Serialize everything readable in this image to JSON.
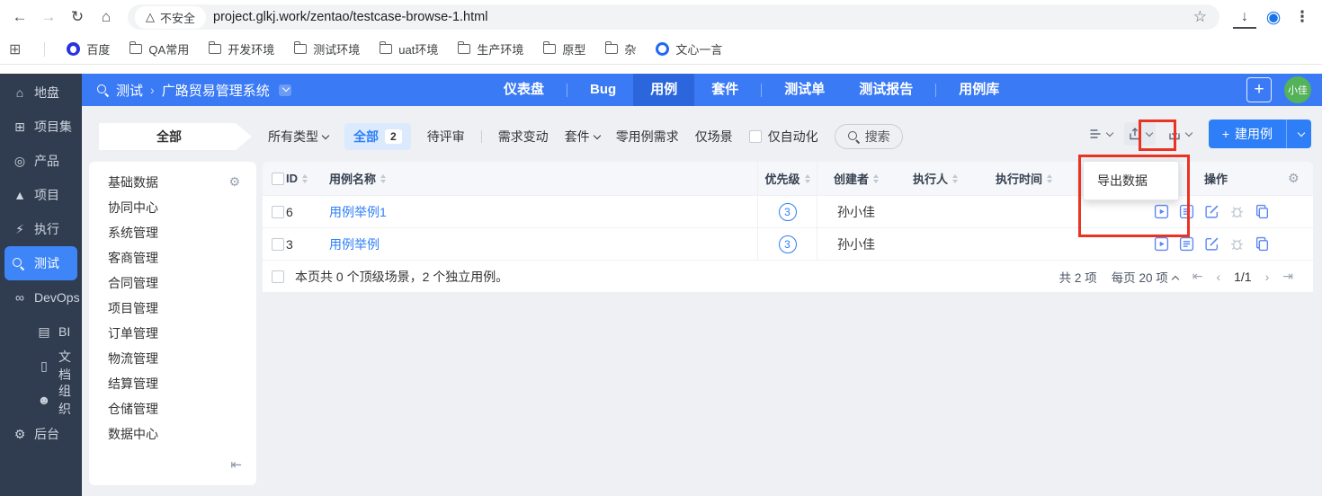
{
  "colors": {
    "primary_blue": "#3a7af5",
    "active_tab_blue": "#2b66dd",
    "sidebar_bg": "#303c4f",
    "sidebar_active_blue": "#3e86f7",
    "link_blue": "#2e7ff7",
    "annotation_red": "#ea3323",
    "avatar_green": "#53b25a"
  },
  "icons": {
    "home": "⌂",
    "grid": "⊞",
    "bulb": "◎",
    "rocket": "▲",
    "run": "⚡",
    "search": "",
    "infinity": "∞",
    "chart": "▤",
    "doc": "▯",
    "people": "☻",
    "gear": "⚙",
    "back": "←",
    "forward": "→",
    "reload": "↻",
    "star": "☆",
    "menu": "⋮",
    "warning": "△",
    "download": "↓",
    "profile": "◉",
    "apps": "⊞",
    "collapse": "⇤",
    "breadcrumb_sep": "›",
    "plus": "+",
    "pager_first": "⇤",
    "pager_prev": "‹",
    "pager_next": "›",
    "pager_last": "⇥",
    "folder": "",
    "baidu": "",
    "wenxin": ""
  },
  "browser": {
    "url": "project.glkj.work/zentao/testcase-browse-1.html",
    "security_label": "不安全",
    "bookmarks": [
      {
        "label": "百度",
        "type": "baidu"
      },
      {
        "label": "QA常用",
        "type": "folder"
      },
      {
        "label": "开发环境",
        "type": "folder"
      },
      {
        "label": "测试环境",
        "type": "folder"
      },
      {
        "label": "uat环境",
        "type": "folder"
      },
      {
        "label": "生产环境",
        "type": "folder"
      },
      {
        "label": "原型",
        "type": "folder"
      },
      {
        "label": "杂",
        "type": "folder"
      },
      {
        "label": "文心一言",
        "type": "wenxin"
      }
    ]
  },
  "sidebar": {
    "items": [
      {
        "label": "地盘",
        "icon": "home"
      },
      {
        "label": "项目集",
        "icon": "grid"
      },
      {
        "label": "产品",
        "icon": "bulb"
      },
      {
        "label": "项目",
        "icon": "rocket"
      },
      {
        "label": "执行",
        "icon": "run"
      },
      {
        "label": "测试",
        "icon": "search",
        "active": true
      },
      {
        "label": "DevOps",
        "icon": "infinity"
      },
      {
        "label": "BI",
        "icon": "chart",
        "divider_before": true
      },
      {
        "label": "文档",
        "icon": "doc",
        "divider_before": true
      },
      {
        "label": "组织",
        "icon": "people",
        "divider_before": true
      },
      {
        "label": "后台",
        "icon": "gear"
      }
    ]
  },
  "topnav": {
    "app": "测试",
    "project": "广路贸易管理系统",
    "tabs": [
      {
        "label": "仪表盘",
        "sep_after": true
      },
      {
        "label": "Bug"
      },
      {
        "label": "用例",
        "active": true
      },
      {
        "label": "套件",
        "sep_after": true
      },
      {
        "label": "测试单"
      },
      {
        "label": "测试报告",
        "sep_after": true
      },
      {
        "label": "用例库"
      }
    ],
    "avatar": "小佳"
  },
  "filterbar": {
    "scope": "全部",
    "type_dropdown": "所有类型",
    "pills": [
      {
        "label": "全部",
        "count": "2",
        "active": true
      },
      {
        "label": "待评审",
        "sep_after": true
      },
      {
        "label": "需求变动"
      },
      {
        "label": "套件",
        "dropdown": true
      },
      {
        "label": "零用例需求"
      },
      {
        "label": "仅场景"
      },
      {
        "label": "仅自动化",
        "checkbox": true
      }
    ],
    "search": "搜索",
    "create_button": "建用例"
  },
  "export_menu": {
    "items": [
      "导出数据"
    ]
  },
  "module_tree": {
    "items": [
      "基础数据",
      "协同中心",
      "系统管理",
      "客商管理",
      "合同管理",
      "项目管理",
      "订单管理",
      "物流管理",
      "结算管理",
      "仓储管理",
      "数据中心"
    ]
  },
  "table": {
    "columns": [
      "ID",
      "用例名称",
      "优先级",
      "创建者",
      "执行人",
      "执行时间",
      "操作"
    ],
    "rows": [
      {
        "id": "6",
        "name": "用例举例1",
        "priority": "3",
        "creator": "孙小佳",
        "executor": "",
        "exec_time": ""
      },
      {
        "id": "3",
        "name": "用例举例",
        "priority": "3",
        "creator": "孙小佳",
        "executor": "",
        "exec_time": ""
      }
    ],
    "summary": "本页共 0 个顶级场景，2 个独立用例。",
    "total": "共 2 项",
    "per_page": "每页 20 项",
    "page": "1/1"
  }
}
